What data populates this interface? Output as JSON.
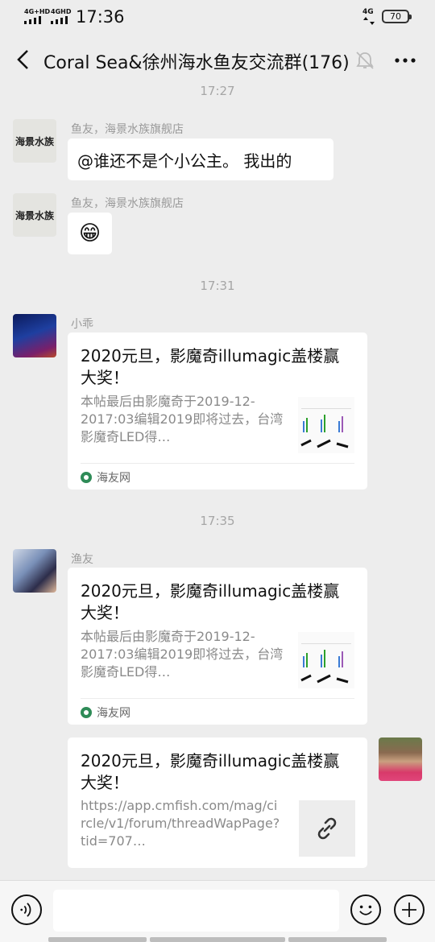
{
  "status_bar": {
    "net1": "4G+HD",
    "net2": "4GHD",
    "time": "17:36",
    "net3": "4G",
    "battery": "70"
  },
  "header": {
    "title": "Coral Sea&徐州海水鱼友交流群(176)"
  },
  "messages": {
    "m1": {
      "sender": "鱼友，海景水族旗舰店",
      "text": "@谁还不是个小公主。 我出的",
      "avatar_text": "海景水族"
    },
    "m2": {
      "sender": "鱼友，海景水族旗舰店",
      "emoji": "😁",
      "avatar_text": "海景水族"
    },
    "ts1": "17:27",
    "ts2": "17:31",
    "m3": {
      "sender": "小乖",
      "title": "2020元旦，影魔奇illumagic盖楼赢大奖！",
      "desc": "本帖最后由影魔奇于2019-12-2017:03编辑2019即将过去，台湾影魔奇LED得…",
      "source": "海友网"
    },
    "ts3": "17:35",
    "m4": {
      "sender": "渔友",
      "title": "2020元旦，影魔奇illumagic盖楼赢大奖！",
      "desc": "本帖最后由影魔奇于2019-12-2017:03编辑2019即将过去，台湾影魔奇LED得…",
      "source": "海友网"
    },
    "m5": {
      "title": "2020元旦，影魔奇illumagic盖楼赢大奖！",
      "desc": "https://app.cmfish.com/mag/circle/v1/forum/threadWapPage?tid=707…"
    }
  },
  "icons": {
    "back": "chevron-left-icon",
    "mute": "bell-off-icon",
    "more": "more-dots-icon",
    "voice": "voice-icon",
    "emoji": "emoji-icon",
    "plus": "plus-icon",
    "link": "link-icon"
  },
  "colors": {
    "background": "#ededed",
    "bubble": "#ffffff",
    "meta_text": "#a6a6a6"
  }
}
